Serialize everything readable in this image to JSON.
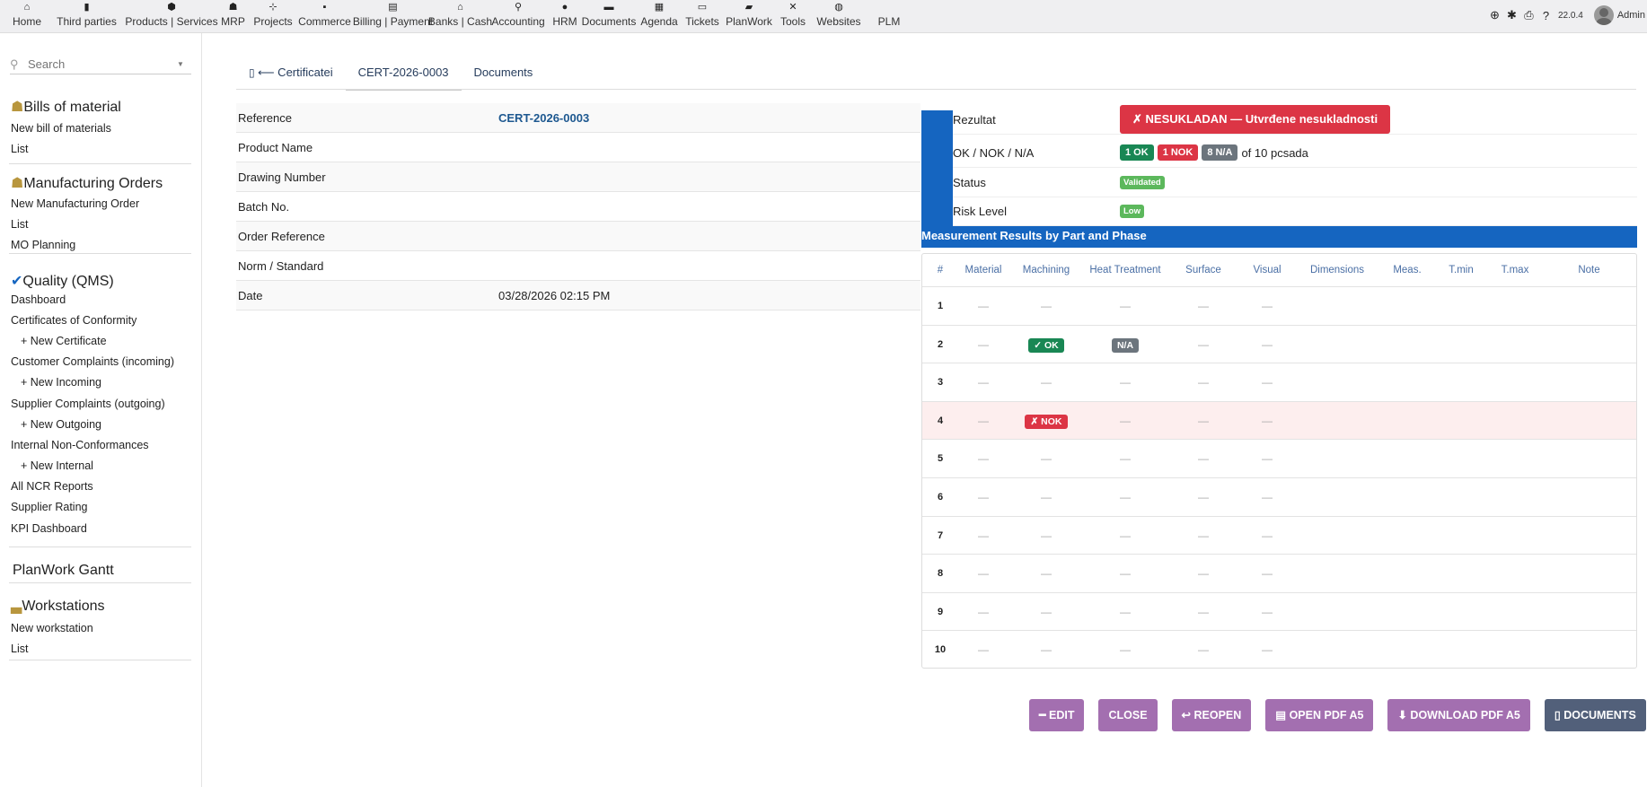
{
  "topmenu": [
    {
      "icon": "home-icon",
      "glyph": "⌂",
      "label": "Home"
    },
    {
      "icon": "building-icon",
      "glyph": "▮",
      "label": "Third parties"
    },
    {
      "icon": "box-icon",
      "glyph": "⬢",
      "label": "Products | Services"
    },
    {
      "icon": "cubes-icon",
      "glyph": "☗",
      "label": "MRP"
    },
    {
      "icon": "sitemap-icon",
      "glyph": "⊹",
      "label": "Projects"
    },
    {
      "icon": "suitcase-icon",
      "glyph": "▪",
      "label": "Commerce"
    },
    {
      "icon": "invoice-icon",
      "glyph": "▤",
      "label": "Billing | Payment"
    },
    {
      "icon": "bank-icon",
      "glyph": "⌂",
      "label": "Banks | Cash"
    },
    {
      "icon": "search-dollar-icon",
      "glyph": "⚲",
      "label": "Accounting"
    },
    {
      "icon": "user-icon",
      "glyph": "●",
      "label": "HRM"
    },
    {
      "icon": "folder-icon",
      "glyph": "▬",
      "label": "Documents"
    },
    {
      "icon": "calendar-icon",
      "glyph": "▦",
      "label": "Agenda"
    },
    {
      "icon": "ticket-icon",
      "glyph": "▭",
      "label": "Tickets"
    },
    {
      "icon": "sticky-note-icon",
      "glyph": "▰",
      "label": "PlanWork"
    },
    {
      "icon": "tools-icon",
      "glyph": "✕",
      "label": "Tools"
    },
    {
      "icon": "globe-icon",
      "glyph": "◍",
      "label": "Websites"
    },
    {
      "icon": "plm-icon",
      "glyph": "",
      "label": "PLM"
    }
  ],
  "topright": {
    "version": "22.0.4",
    "user": "Admin"
  },
  "sidebar": {
    "search_placeholder": "Search",
    "bom": {
      "title": "Bills of material",
      "items": [
        "New bill of materials",
        "List"
      ]
    },
    "mo": {
      "title": "Manufacturing Orders",
      "items": [
        "New Manufacturing Order",
        "List",
        "MO Planning"
      ]
    },
    "qms": {
      "title": "Quality (QMS)",
      "items": [
        "Dashboard",
        "Certificates of Conformity",
        "+ New Certificate",
        "Customer Complaints (incoming)",
        "+ New Incoming",
        "Supplier Complaints (outgoing)",
        "+ New Outgoing",
        "Internal Non-Conformances",
        "+ New Internal",
        "All NCR Reports",
        "Supplier Rating",
        "KPI Dashboard"
      ]
    },
    "planwork": {
      "title": "PlanWork Gantt"
    },
    "ws": {
      "title": "Workstations",
      "items": [
        "New workstation",
        "List"
      ]
    }
  },
  "tabs": [
    "⟵ Certificatei",
    "CERT-2026-0003",
    "Documents"
  ],
  "fields": [
    {
      "label": "Reference",
      "value": "CERT-2026-0003"
    },
    {
      "label": "Product Name",
      "value": ""
    },
    {
      "label": "Drawing Number",
      "value": ""
    },
    {
      "label": "Batch No.",
      "value": ""
    },
    {
      "label": "Order Reference",
      "value": ""
    },
    {
      "label": "Norm / Standard",
      "value": ""
    },
    {
      "label": "Date",
      "value": "03/28/2026 02:15 PM"
    }
  ],
  "result": {
    "label": "Rezultat",
    "value": "✗ NESUKLADAN — Utvrđene nesukladnosti",
    "counts_label": "OK / NOK / N/A",
    "ok": "1 OK",
    "nok": "1 NOK",
    "na": "8 N/A",
    "of": "of 10 pcsada",
    "status_label": "Status",
    "status": "Validated",
    "risk_label": "Risk Level",
    "risk": "Low",
    "colors": {
      "danger": "#dc3545",
      "success": "#198754",
      "neutral": "#6c757d",
      "primary": "#1565c0"
    }
  },
  "measure": {
    "title": "Measurement Results by Part and Phase",
    "headers": [
      "#",
      "Material",
      "Machining",
      "Heat Treatment",
      "Surface",
      "Visual",
      "Dimensions",
      "Meas.",
      "T.min",
      "T.max",
      "Note"
    ],
    "rows": [
      {
        "n": "1",
        "cells": [
          "—",
          "—",
          "—",
          "—",
          "—"
        ]
      },
      {
        "n": "2",
        "cells": [
          "—",
          "✓ OK",
          "N/A",
          "—",
          "—"
        ]
      },
      {
        "n": "3",
        "cells": [
          "—",
          "—",
          "—",
          "—",
          "—"
        ]
      },
      {
        "n": "4",
        "cells": [
          "—",
          "✗ NOK",
          "—",
          "—",
          "—"
        ],
        "nok": true
      },
      {
        "n": "5",
        "cells": [
          "—",
          "—",
          "—",
          "—",
          "—"
        ]
      },
      {
        "n": "6",
        "cells": [
          "—",
          "—",
          "—",
          "—",
          "—"
        ]
      },
      {
        "n": "7",
        "cells": [
          "—",
          "—",
          "—",
          "—",
          "—"
        ]
      },
      {
        "n": "8",
        "cells": [
          "—",
          "—",
          "—",
          "—",
          "—"
        ]
      },
      {
        "n": "9",
        "cells": [
          "—",
          "—",
          "—",
          "—",
          "—"
        ]
      },
      {
        "n": "10",
        "cells": [
          "—",
          "—",
          "—",
          "—",
          "—"
        ]
      }
    ]
  },
  "actions": [
    {
      "label": "━ EDIT",
      "name": "edit-button"
    },
    {
      "label": "CLOSE",
      "name": "close-button"
    },
    {
      "label": "↩ REOPEN",
      "name": "reopen-button"
    },
    {
      "label": "▤ OPEN PDF A5",
      "name": "open-pdf-button"
    },
    {
      "label": "⬇ DOWNLOAD PDF A5",
      "name": "download-pdf-button"
    },
    {
      "label": "▯ DOCUMENTS",
      "name": "documents-button"
    }
  ]
}
